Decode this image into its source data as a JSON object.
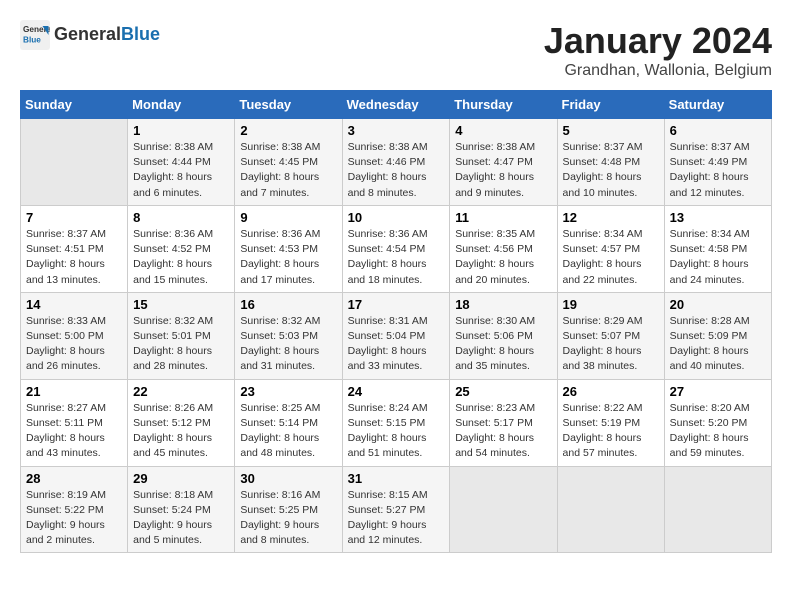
{
  "header": {
    "logo_line1": "General",
    "logo_line2": "Blue",
    "title": "January 2024",
    "subtitle": "Grandhan, Wallonia, Belgium"
  },
  "weekdays": [
    "Sunday",
    "Monday",
    "Tuesday",
    "Wednesday",
    "Thursday",
    "Friday",
    "Saturday"
  ],
  "weeks": [
    [
      {
        "day": "",
        "empty": true
      },
      {
        "day": "1",
        "info": "Sunrise: 8:38 AM\nSunset: 4:44 PM\nDaylight: 8 hours\nand 6 minutes."
      },
      {
        "day": "2",
        "info": "Sunrise: 8:38 AM\nSunset: 4:45 PM\nDaylight: 8 hours\nand 7 minutes."
      },
      {
        "day": "3",
        "info": "Sunrise: 8:38 AM\nSunset: 4:46 PM\nDaylight: 8 hours\nand 8 minutes."
      },
      {
        "day": "4",
        "info": "Sunrise: 8:38 AM\nSunset: 4:47 PM\nDaylight: 8 hours\nand 9 minutes."
      },
      {
        "day": "5",
        "info": "Sunrise: 8:37 AM\nSunset: 4:48 PM\nDaylight: 8 hours\nand 10 minutes."
      },
      {
        "day": "6",
        "info": "Sunrise: 8:37 AM\nSunset: 4:49 PM\nDaylight: 8 hours\nand 12 minutes."
      }
    ],
    [
      {
        "day": "7",
        "info": "Sunrise: 8:37 AM\nSunset: 4:51 PM\nDaylight: 8 hours\nand 13 minutes."
      },
      {
        "day": "8",
        "info": "Sunrise: 8:36 AM\nSunset: 4:52 PM\nDaylight: 8 hours\nand 15 minutes."
      },
      {
        "day": "9",
        "info": "Sunrise: 8:36 AM\nSunset: 4:53 PM\nDaylight: 8 hours\nand 17 minutes."
      },
      {
        "day": "10",
        "info": "Sunrise: 8:36 AM\nSunset: 4:54 PM\nDaylight: 8 hours\nand 18 minutes."
      },
      {
        "day": "11",
        "info": "Sunrise: 8:35 AM\nSunset: 4:56 PM\nDaylight: 8 hours\nand 20 minutes."
      },
      {
        "day": "12",
        "info": "Sunrise: 8:34 AM\nSunset: 4:57 PM\nDaylight: 8 hours\nand 22 minutes."
      },
      {
        "day": "13",
        "info": "Sunrise: 8:34 AM\nSunset: 4:58 PM\nDaylight: 8 hours\nand 24 minutes."
      }
    ],
    [
      {
        "day": "14",
        "info": "Sunrise: 8:33 AM\nSunset: 5:00 PM\nDaylight: 8 hours\nand 26 minutes."
      },
      {
        "day": "15",
        "info": "Sunrise: 8:32 AM\nSunset: 5:01 PM\nDaylight: 8 hours\nand 28 minutes."
      },
      {
        "day": "16",
        "info": "Sunrise: 8:32 AM\nSunset: 5:03 PM\nDaylight: 8 hours\nand 31 minutes."
      },
      {
        "day": "17",
        "info": "Sunrise: 8:31 AM\nSunset: 5:04 PM\nDaylight: 8 hours\nand 33 minutes."
      },
      {
        "day": "18",
        "info": "Sunrise: 8:30 AM\nSunset: 5:06 PM\nDaylight: 8 hours\nand 35 minutes."
      },
      {
        "day": "19",
        "info": "Sunrise: 8:29 AM\nSunset: 5:07 PM\nDaylight: 8 hours\nand 38 minutes."
      },
      {
        "day": "20",
        "info": "Sunrise: 8:28 AM\nSunset: 5:09 PM\nDaylight: 8 hours\nand 40 minutes."
      }
    ],
    [
      {
        "day": "21",
        "info": "Sunrise: 8:27 AM\nSunset: 5:11 PM\nDaylight: 8 hours\nand 43 minutes."
      },
      {
        "day": "22",
        "info": "Sunrise: 8:26 AM\nSunset: 5:12 PM\nDaylight: 8 hours\nand 45 minutes."
      },
      {
        "day": "23",
        "info": "Sunrise: 8:25 AM\nSunset: 5:14 PM\nDaylight: 8 hours\nand 48 minutes."
      },
      {
        "day": "24",
        "info": "Sunrise: 8:24 AM\nSunset: 5:15 PM\nDaylight: 8 hours\nand 51 minutes."
      },
      {
        "day": "25",
        "info": "Sunrise: 8:23 AM\nSunset: 5:17 PM\nDaylight: 8 hours\nand 54 minutes."
      },
      {
        "day": "26",
        "info": "Sunrise: 8:22 AM\nSunset: 5:19 PM\nDaylight: 8 hours\nand 57 minutes."
      },
      {
        "day": "27",
        "info": "Sunrise: 8:20 AM\nSunset: 5:20 PM\nDaylight: 8 hours\nand 59 minutes."
      }
    ],
    [
      {
        "day": "28",
        "info": "Sunrise: 8:19 AM\nSunset: 5:22 PM\nDaylight: 9 hours\nand 2 minutes."
      },
      {
        "day": "29",
        "info": "Sunrise: 8:18 AM\nSunset: 5:24 PM\nDaylight: 9 hours\nand 5 minutes."
      },
      {
        "day": "30",
        "info": "Sunrise: 8:16 AM\nSunset: 5:25 PM\nDaylight: 9 hours\nand 8 minutes."
      },
      {
        "day": "31",
        "info": "Sunrise: 8:15 AM\nSunset: 5:27 PM\nDaylight: 9 hours\nand 12 minutes."
      },
      {
        "day": "",
        "empty": true
      },
      {
        "day": "",
        "empty": true
      },
      {
        "day": "",
        "empty": true
      }
    ]
  ]
}
